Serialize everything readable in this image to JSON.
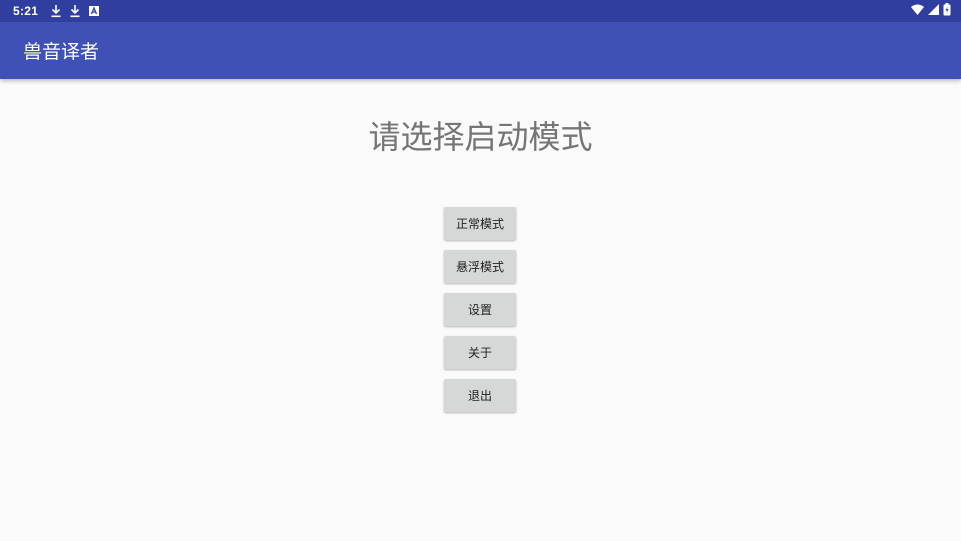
{
  "status_bar": {
    "time": "5:21",
    "notification_icons": [
      "download-icon",
      "download-icon",
      "app-notification-icon"
    ],
    "system_icons": [
      "wifi-icon",
      "cellular-signal-icon",
      "battery-icon"
    ]
  },
  "app_bar": {
    "title": "兽音译者",
    "color": "#3f51b5"
  },
  "main": {
    "heading": "请选择启动模式",
    "buttons": {
      "normal_mode": "正常模式",
      "floating_mode": "悬浮模式",
      "settings": "设置",
      "about": "关于",
      "exit": "退出"
    }
  },
  "colors": {
    "status_bar": "#303f9f",
    "app_bar": "#3f51b5",
    "background": "#fafafa",
    "button": "#d6d7d7"
  }
}
